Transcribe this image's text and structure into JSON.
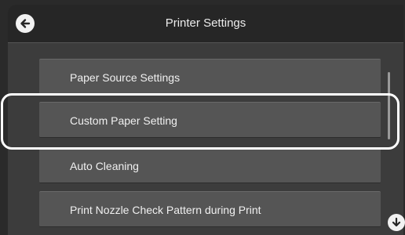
{
  "header": {
    "title": "Printer Settings",
    "back_icon": "arrow-left-circle-icon"
  },
  "menu": {
    "items": [
      {
        "label": "Paper Source Settings"
      },
      {
        "label": "Custom Paper Setting",
        "highlighted": true
      },
      {
        "label": "Auto Cleaning"
      },
      {
        "label": "Print Nozzle Check Pattern during Print"
      }
    ]
  },
  "scroll": {
    "down_icon": "arrow-down-circle-icon"
  },
  "colors": {
    "background": "#3c3c3c",
    "header": "#262626",
    "item": "#555555",
    "text": "#f0f0f0",
    "highlight": "#ffffff"
  }
}
